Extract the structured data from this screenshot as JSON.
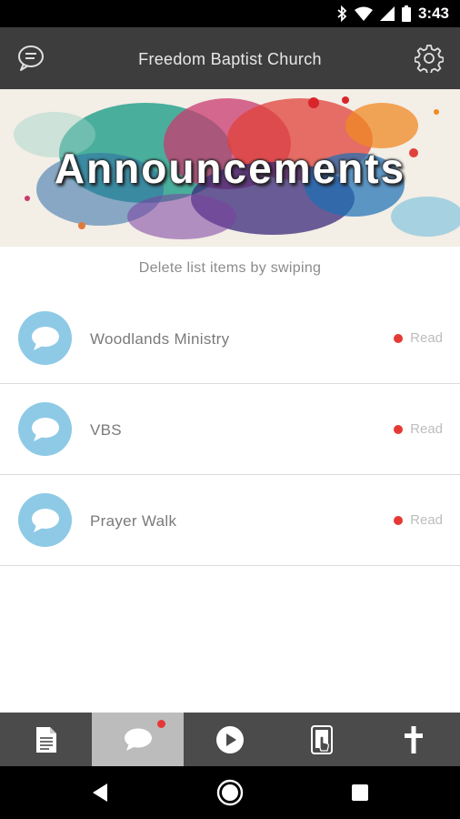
{
  "status_bar": {
    "time": "3:43"
  },
  "header": {
    "title": "Freedom Baptist Church"
  },
  "banner": {
    "title": "Announcements"
  },
  "list_hint": "Delete list items by swiping",
  "announcements": [
    {
      "title": "Woodlands Ministry",
      "status": "Read"
    },
    {
      "title": "VBS",
      "status": "Read"
    },
    {
      "title": "Prayer Walk",
      "status": "Read"
    }
  ],
  "bottom_nav": {
    "tabs": [
      {
        "icon": "document-icon",
        "active": false
      },
      {
        "icon": "chat-bubble-icon",
        "active": true,
        "badge": true
      },
      {
        "icon": "play-icon",
        "active": false
      },
      {
        "icon": "tablet-touch-icon",
        "active": false
      },
      {
        "icon": "cross-icon",
        "active": false
      }
    ]
  },
  "colors": {
    "header_bg": "#3d3d3d",
    "avatar": "#8ecae6",
    "badge": "#e53935",
    "nav_bg": "#4b4b4b",
    "nav_active": "#bcbcbc"
  }
}
